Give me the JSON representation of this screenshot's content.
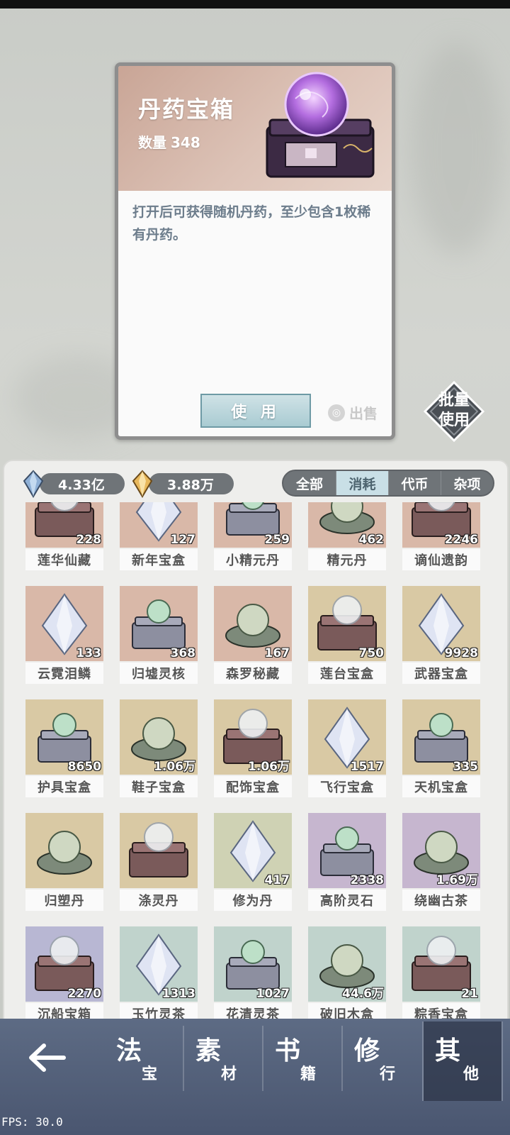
{
  "detail": {
    "title": "丹药宝箱",
    "qty_label": "数量",
    "qty_value": "348",
    "description": "打开后可获得随机丹药，至少包含1枚稀有丹药。",
    "use_label": "使 用",
    "sell_label": "出售",
    "icon": "treasure-chest-with-orb"
  },
  "batch_use": {
    "line1": "批量",
    "line2": "使用"
  },
  "currencies": [
    {
      "icon": "blue-crystal-icon",
      "value": "4.33亿"
    },
    {
      "icon": "gold-crystal-icon",
      "value": "3.88万"
    }
  ],
  "tabs": [
    {
      "label": "全部",
      "active": false
    },
    {
      "label": "消耗",
      "active": true
    },
    {
      "label": "代币",
      "active": false
    },
    {
      "label": "杂项",
      "active": false
    }
  ],
  "items": [
    {
      "name": "莲华仙藏",
      "count": "228",
      "bg": "#d9b8a8",
      "icon": "lotus-treasure"
    },
    {
      "name": "新年宝盒",
      "count": "127",
      "bg": "#d9b8a8",
      "icon": "new-year-box"
    },
    {
      "name": "小精元丹",
      "count": "259",
      "bg": "#d9b8a8",
      "icon": "small-essence-pill"
    },
    {
      "name": "精元丹",
      "count": "462",
      "bg": "#d9b8a8",
      "icon": "essence-pill"
    },
    {
      "name": "谪仙遗韵",
      "count": "2246",
      "bg": "#d9b8a8",
      "icon": "immortal-relic"
    },
    {
      "name": "云霓泪鳞",
      "count": "133",
      "bg": "#d9b8a8",
      "icon": "teardrop-scale"
    },
    {
      "name": "归墟灵核",
      "count": "368",
      "bg": "#d9b8a8",
      "icon": "spirit-core"
    },
    {
      "name": "森罗秘藏",
      "count": "167",
      "bg": "#d9b8a8",
      "icon": "secret-treasure"
    },
    {
      "name": "莲台宝盒",
      "count": "750",
      "bg": "#d9c9a4",
      "icon": "lotus-box"
    },
    {
      "name": "武器宝盒",
      "count": "9928",
      "bg": "#d9c9a4",
      "icon": "weapon-box"
    },
    {
      "name": "护具宝盒",
      "count": "8650",
      "bg": "#d9c9a4",
      "icon": "armor-box"
    },
    {
      "name": "鞋子宝盒",
      "count": "1.06万",
      "bg": "#d9c9a4",
      "icon": "shoes-box"
    },
    {
      "name": "配饰宝盒",
      "count": "1.06万",
      "bg": "#d9c9a4",
      "icon": "accessory-box"
    },
    {
      "name": "飞行宝盒",
      "count": "1517",
      "bg": "#d9c9a4",
      "icon": "flight-box"
    },
    {
      "name": "天机宝盒",
      "count": "335",
      "bg": "#d9c9a4",
      "icon": "heaven-box"
    },
    {
      "name": "归塑丹",
      "count": "",
      "bg": "#d9c9a4",
      "icon": "purple-orb-box"
    },
    {
      "name": "涤灵丹",
      "count": "",
      "bg": "#d9c9a4",
      "icon": "green-orb-box"
    },
    {
      "name": "修为丹",
      "count": "417",
      "bg": "#cfd2b4",
      "icon": "cultivation-pill-box"
    },
    {
      "name": "高阶灵石",
      "count": "2338",
      "bg": "#c6b6cf",
      "icon": "spirit-stone"
    },
    {
      "name": "绕幽古茶",
      "count": "1.69万",
      "bg": "#c6b6cf",
      "icon": "ancient-tea"
    },
    {
      "name": "沉船宝箱",
      "count": "2270",
      "bg": "#b8b7d3",
      "icon": "shipwreck-chest"
    },
    {
      "name": "玉竹灵茶",
      "count": "1313",
      "bg": "#c0d3cc",
      "icon": "jade-tea"
    },
    {
      "name": "花清灵茶",
      "count": "1027",
      "bg": "#c0d3cc",
      "icon": "flower-tea"
    },
    {
      "name": "破旧木盒",
      "count": "44.6万",
      "bg": "#c0d3cc",
      "icon": "old-wood-box"
    },
    {
      "name": "粽香宝盒",
      "count": "21",
      "bg": "#c0d3cc",
      "icon": "zongzi-box"
    }
  ],
  "nav": [
    {
      "big": "法",
      "small": "宝",
      "active": false
    },
    {
      "big": "素",
      "small": "材",
      "active": false
    },
    {
      "big": "书",
      "small": "籍",
      "active": false
    },
    {
      "big": "修",
      "small": "行",
      "active": false
    },
    {
      "big": "其",
      "small": "他",
      "active": true
    }
  ],
  "fps": "FPS: 30.0"
}
